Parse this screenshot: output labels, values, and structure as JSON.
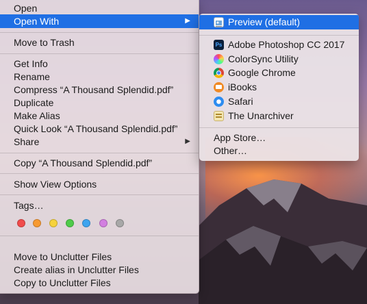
{
  "menu": {
    "items": [
      {
        "label": "Open"
      },
      {
        "label": "Open With"
      },
      {
        "label": "Move to Trash"
      },
      {
        "label": "Get Info"
      },
      {
        "label": "Rename"
      },
      {
        "label": "Compress “A Thousand Splendid.pdf”"
      },
      {
        "label": "Duplicate"
      },
      {
        "label": "Make Alias"
      },
      {
        "label": "Quick Look “A Thousand Splendid.pdf”"
      },
      {
        "label": "Share"
      },
      {
        "label": "Copy “A Thousand Splendid.pdf”"
      },
      {
        "label": "Show View Options"
      },
      {
        "label": "Tags…"
      },
      {
        "label": "Move to Unclutter Files"
      },
      {
        "label": "Create alias in Unclutter Files"
      },
      {
        "label": "Copy to Unclutter Files"
      }
    ],
    "selected_item": "Open With",
    "submenu_arrow": "▶",
    "tag_colors": [
      {
        "name": "red",
        "color": "#f14b4b"
      },
      {
        "name": "orange",
        "color": "#f79a32"
      },
      {
        "name": "yellow",
        "color": "#f6d23c"
      },
      {
        "name": "green",
        "color": "#4fcb4a"
      },
      {
        "name": "blue",
        "color": "#3ea4ef"
      },
      {
        "name": "purple",
        "color": "#d27fe0"
      },
      {
        "name": "gray",
        "color": "#a8a8a8"
      }
    ]
  },
  "submenu": {
    "items": [
      {
        "label": "Preview (default)",
        "icon": "preview-icon"
      },
      {
        "label": "Adobe Photoshop CC 2017",
        "icon": "photoshop-icon",
        "icon_text": "Ps"
      },
      {
        "label": "ColorSync Utility",
        "icon": "colorsync-icon"
      },
      {
        "label": "Google Chrome",
        "icon": "chrome-icon"
      },
      {
        "label": "iBooks",
        "icon": "ibooks-icon"
      },
      {
        "label": "Safari",
        "icon": "safari-icon"
      },
      {
        "label": "The Unarchiver",
        "icon": "unarchiver-icon"
      },
      {
        "label": "App Store…"
      },
      {
        "label": "Other…"
      }
    ]
  },
  "colors": {
    "selection": "#1f6fe4"
  }
}
